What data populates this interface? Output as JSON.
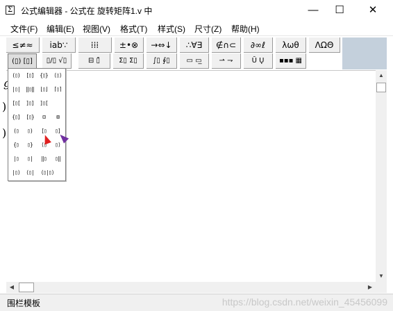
{
  "window": {
    "title": "公式编辑器 - 公式在 旋转矩阵1.v 中",
    "icon_glyph": "Σ",
    "minimize": "—",
    "maximize": "☐",
    "close": "✕"
  },
  "menu": [
    "文件(F)",
    "编辑(E)",
    "视图(V)",
    "格式(T)",
    "样式(S)",
    "尺寸(Z)",
    "帮助(H)"
  ],
  "toolbar_row1": [
    "≤≠≈",
    "ⅰab∵",
    "⁞⁞⁞",
    "±•⊗",
    "→⇔↓",
    "∴∀∃",
    "∉∩⊂",
    "∂∞ℓ",
    "λωθ",
    "ΛΩΘ"
  ],
  "toolbar_row2": [
    "(▯) [▯]",
    "▯/▯ √▯",
    "⊟ ▯̄",
    "Σ▯ Σ▯",
    "∫▯ ∮▯",
    "▭ ▭̲",
    "⇀ ⇁",
    "Ū Ų",
    "▪▪▪ ▦"
  ],
  "palette": [
    [
      "(▯)",
      "[▯]",
      "{▯}",
      "⟨▯⟩"
    ],
    [
      "|▯|",
      "‖▯‖",
      "⌊▯⌋",
      "⌈▯⌉"
    ],
    [
      "[▯[",
      "]▯]",
      "]▯[",
      ""
    ],
    [
      "{▯]",
      "[▯}",
      "⊟",
      "⊞"
    ],
    [
      "(▯",
      "▯)",
      "[▯",
      "▯]"
    ],
    [
      "{▯",
      "▯}",
      "⟨▯",
      "▯⟩"
    ],
    [
      "|▯",
      "▯|",
      "‖▯",
      "▯‖"
    ],
    [
      "|▯⟩",
      "⟨▯|",
      "⟨▯|▯⟩",
      ""
    ]
  ],
  "canvas": {
    "partial_glyphs": [
      "g",
      ")",
      ")"
    ]
  },
  "scroll": {
    "up": "▲",
    "down": "▼",
    "left": "◀",
    "right": "▶"
  },
  "status": {
    "text": "围栏模板",
    "watermark": "https://blog.csdn.net/weixin_45456099"
  },
  "colors": {
    "accent_panel": "#c4d0dc",
    "arrow_red": "#e02020",
    "arrow_purple": "#7030a0"
  }
}
